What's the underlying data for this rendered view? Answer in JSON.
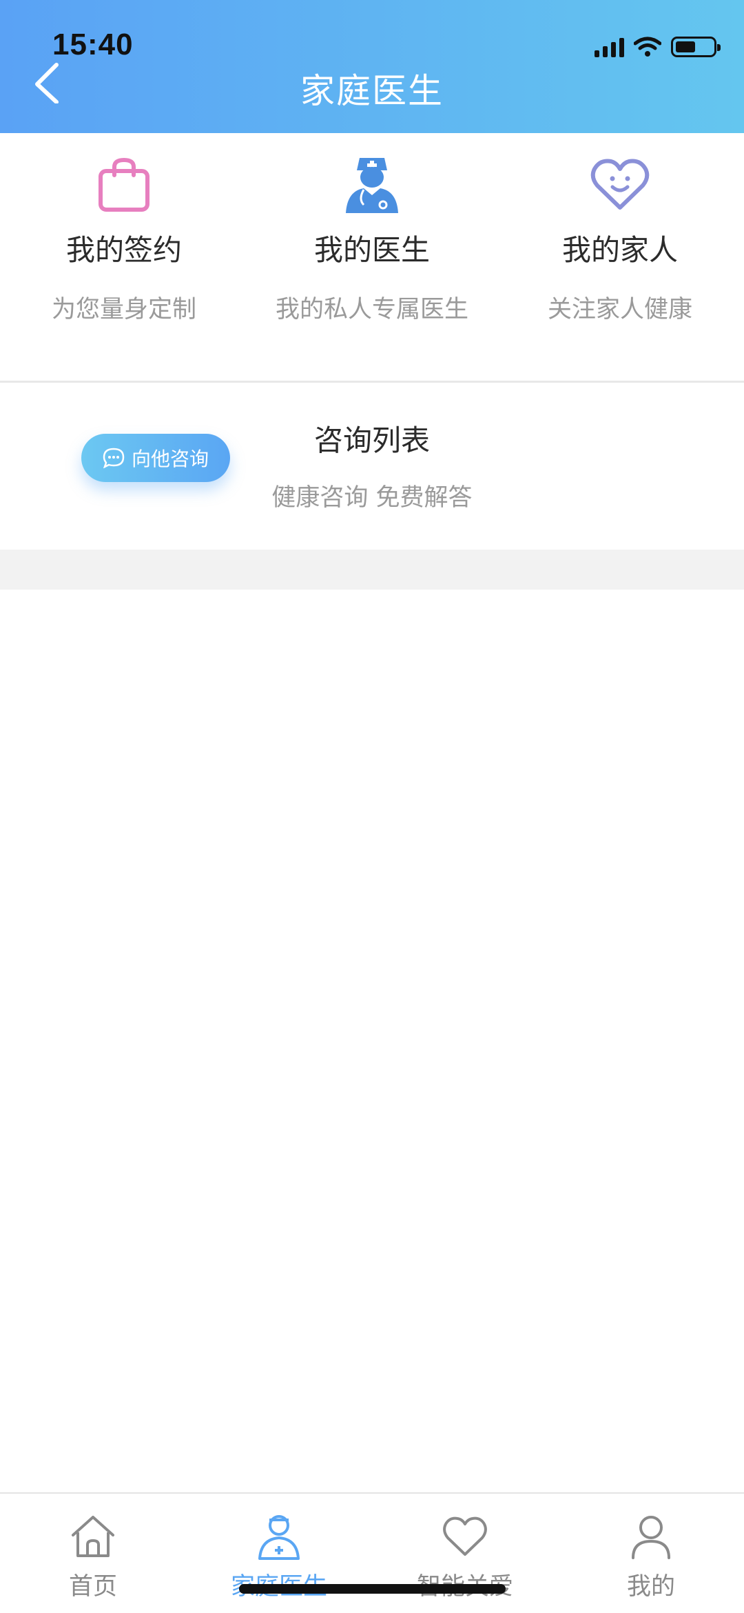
{
  "status_bar": {
    "time": "15:40"
  },
  "header": {
    "title": "家庭医生"
  },
  "quick_cards": [
    {
      "title": "我的签约",
      "subtitle": "为您量身定制",
      "icon": "shopping-bag-icon",
      "color": "#e77fbf"
    },
    {
      "title": "我的医生",
      "subtitle": "我的私人专属医生",
      "icon": "doctor-icon",
      "color": "#4a8fe0"
    },
    {
      "title": "我的家人",
      "subtitle": "关注家人健康",
      "icon": "heart-smile-icon",
      "color": "#8a90d8"
    }
  ],
  "consult": {
    "button_label": "向他咨询",
    "title": "咨询列表",
    "subtitle": "健康咨询 免费解答"
  },
  "tabbar": {
    "items": [
      {
        "label": "首页",
        "icon": "home-icon",
        "active": false
      },
      {
        "label": "家庭医生",
        "icon": "family-doctor-icon",
        "active": true
      },
      {
        "label": "智能关爱",
        "icon": "heart-icon",
        "active": false
      },
      {
        "label": "我的",
        "icon": "user-icon",
        "active": false
      }
    ]
  },
  "colors": {
    "accent": "#5aa6f3",
    "header_start": "#5aa2f5",
    "header_end": "#64c6ef"
  }
}
